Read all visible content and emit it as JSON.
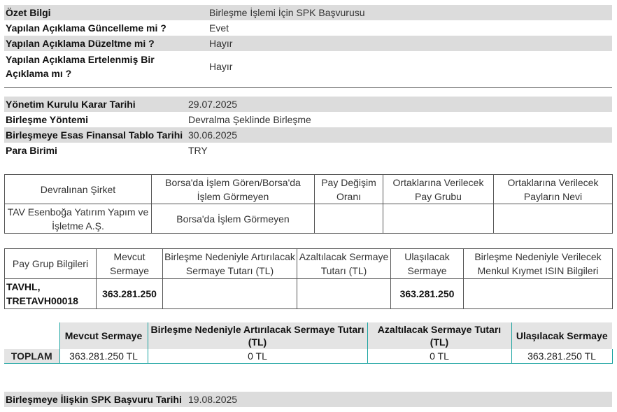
{
  "summary": {
    "rows": [
      {
        "label": "Özet Bilgi",
        "value": "Birleşme İşlemi İçin SPK Başvurusu"
      },
      {
        "label": "Yapılan Açıklama Güncelleme mi ?",
        "value": "Evet"
      },
      {
        "label": "Yapılan Açıklama Düzeltme mi ?",
        "value": "Hayır"
      },
      {
        "label": "Yapılan Açıklama Ertelenmiş Bir Açıklama mı ?",
        "value": "Hayır"
      }
    ]
  },
  "details": {
    "rows": [
      {
        "label": "Yönetim Kurulu Karar Tarihi",
        "value": "29.07.2025"
      },
      {
        "label": "Birleşme Yöntemi",
        "value": "Devralma Şeklinde Birleşme"
      },
      {
        "label": "Birleşmeye Esas Finansal Tablo Tarihi",
        "value": "30.06.2025"
      },
      {
        "label": "Para Birimi",
        "value": "TRY"
      }
    ]
  },
  "company_table": {
    "headers": [
      "Devralınan Şirket",
      "Borsa'da İşlem Gören/Borsa'da İşlem Görmeyen",
      "Pay Değişim Oranı",
      "Ortaklarına Verilecek Pay Grubu",
      "Ortaklarına Verilecek Payların Nevi"
    ],
    "row": [
      "TAV Esenboğa Yatırım Yapım ve İşletme A.Ş.",
      "Borsa'da İşlem Görmeyen",
      "",
      "",
      ""
    ]
  },
  "share_table": {
    "headers": [
      "Pay Grup Bilgileri",
      "Mevcut Sermaye",
      "Birleşme Nedeniyle Artırılacak Sermaye Tutarı (TL)",
      "Azaltılacak Sermaye Tutarı (TL)",
      "Ulaşılacak Sermaye",
      "Birleşme Nedeniyle Verilecek Menkul Kıymet ISIN Bilgileri"
    ],
    "row": [
      "TAVHL, TRETAVH00018",
      "363.281.250",
      "",
      "",
      "363.281.250",
      ""
    ]
  },
  "total_table": {
    "headers": [
      "",
      "Mevcut Sermaye",
      "Birleşme Nedeniyle Artırılacak Sermaye Tutarı (TL)",
      "Azaltılacak Sermaye Tutarı (TL)",
      "Ulaşılacak Sermaye"
    ],
    "row": [
      "TOPLAM",
      "363.281.250 TL",
      "0 TL",
      "0 TL",
      "363.281.250 TL"
    ]
  },
  "application": {
    "label": "Birleşmeye İlişkin SPK Başvuru Tarihi",
    "value": "19.08.2025"
  }
}
